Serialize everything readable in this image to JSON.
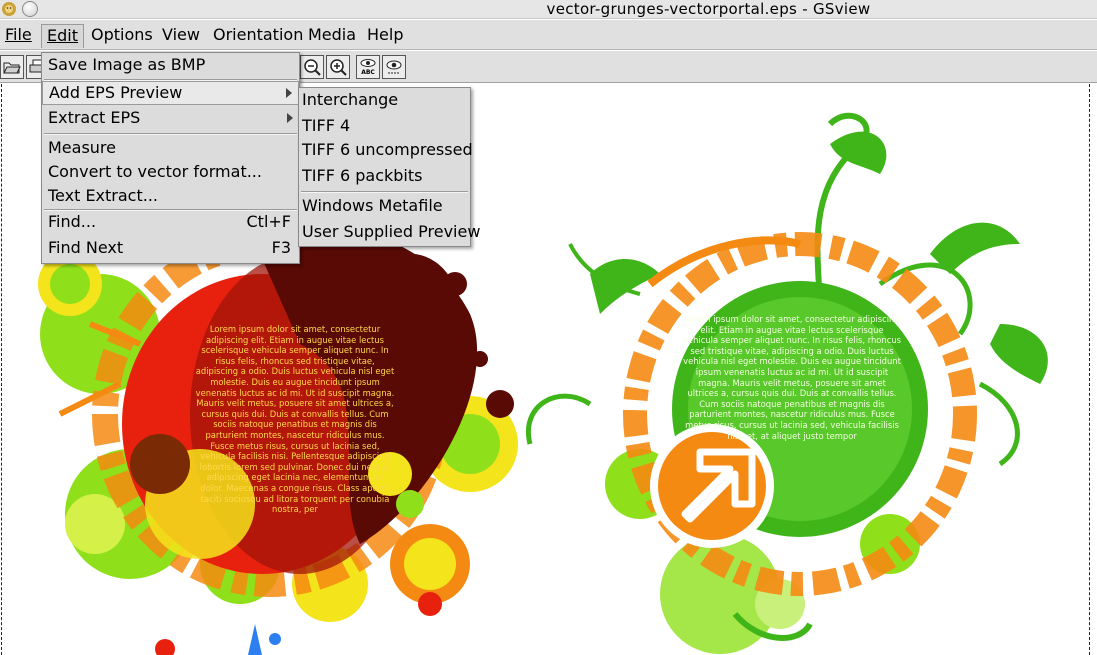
{
  "window": {
    "title": "vector-grunges-vectorportal.eps - GSview",
    "app_icon": "gsview-lion-icon",
    "close_icon": "close-circle-icon"
  },
  "menubar": {
    "items": [
      {
        "label": "File",
        "underline": "F"
      },
      {
        "label": "Edit",
        "underline": "E"
      },
      {
        "label": "Options",
        "underline": "O"
      },
      {
        "label": "View",
        "underline": "V"
      },
      {
        "label": "Orientation",
        "underline": "O"
      },
      {
        "label": "Media",
        "underline": "M"
      },
      {
        "label": "Help",
        "underline": "H"
      }
    ],
    "open_item": "Edit"
  },
  "toolbar": {
    "icons": [
      "open-icon",
      "print-icon",
      "zoom-out-icon",
      "zoom-in-icon",
      "text-eye-icon",
      "eye-icon"
    ],
    "text_eye_caption": "ABC"
  },
  "edit_menu": {
    "items": [
      {
        "label": "Save Image as BMP",
        "shortcut": "",
        "submenu": false
      },
      {
        "label": "Add EPS Preview",
        "shortcut": "",
        "submenu": true
      },
      {
        "label": "Extract EPS",
        "shortcut": "",
        "submenu": true
      },
      {
        "label": "Measure",
        "shortcut": "",
        "submenu": false
      },
      {
        "label": "Convert to vector format...",
        "shortcut": "",
        "submenu": false
      },
      {
        "label": "Text Extract...",
        "shortcut": "",
        "submenu": false
      },
      {
        "label": "Find...",
        "shortcut": "Ctl+F",
        "submenu": false
      },
      {
        "label": "Find Next",
        "shortcut": "F3",
        "submenu": false
      }
    ]
  },
  "preview_submenu": {
    "items": [
      {
        "label": "Interchange"
      },
      {
        "label": "TIFF 4"
      },
      {
        "label": "TIFF 6 uncompressed"
      },
      {
        "label": "TIFF 6 packbits"
      },
      {
        "label": "Windows Metafile"
      },
      {
        "label": "User Supplied Preview"
      }
    ]
  },
  "document": {
    "left_text": "Lorem ipsum dolor sit amet, consectetur adipiscing elit. Etiam in augue vitae lectus scelerisque vehicula semper aliquet nunc. In risus felis, rhoncus sed tristique vitae, adipiscing a odio. Duis luctus vehicula nisl eget molestie. Duis eu augue tincidunt ipsum venenatis luctus ac id mi. Ut id suscipit magna. Mauris velit metus, posuere sit amet ultrices a, cursus quis dui. Duis at convallis tellus. Cum sociis natoque penatibus et magnis dis parturient montes, nascetur ridiculus mus. Fusce metus risus, cursus ut lacinia sed, vehicula facilisis nisi. Pellentesque adipiscing lobortis lorem sed pulvinar. Donec dui neque, adipiscing eget lacinia nec, elementum ac dolor. Maecenas a congue risus. Class aptent taciti sociosqu ad litora torquent per conubia nostra, per",
    "right_text": "Lorem ipsum dolor sit amet, consectetur adipiscing elit. Etiam in augue vitae lectus scelerisque vehicula semper aliquet nunc. In risus felis, rhoncus sed tristique vitae, adipiscing a odio. Duis luctus vehicula nisl eget molestie. Duis eu augue tincidunt ipsum venenatis luctus ac id mi. Ut id suscipit magna. Mauris velit metus, posuere sit amet ultrices a, cursus quis dui. Duis at convallis tellus. Cum sociis natoque penatibus et magnis dis parturient montes, nascetur ridiculus mus. Fusce metus risus, cursus ut lacinia sed, vehicula facilisis nisi. et, at aliquet justo tempor",
    "logo_icon": "vectorportal-arrow-logo-icon",
    "colors": {
      "splash_dark": "#5a0a05",
      "splash_red": "#e8210f",
      "orange": "#f58a12",
      "yellow": "#f3e41b",
      "lime": "#8fe01a",
      "green": "#3fb51a",
      "dark_green": "#1f8e0f",
      "blue": "#2d7ff0"
    }
  }
}
